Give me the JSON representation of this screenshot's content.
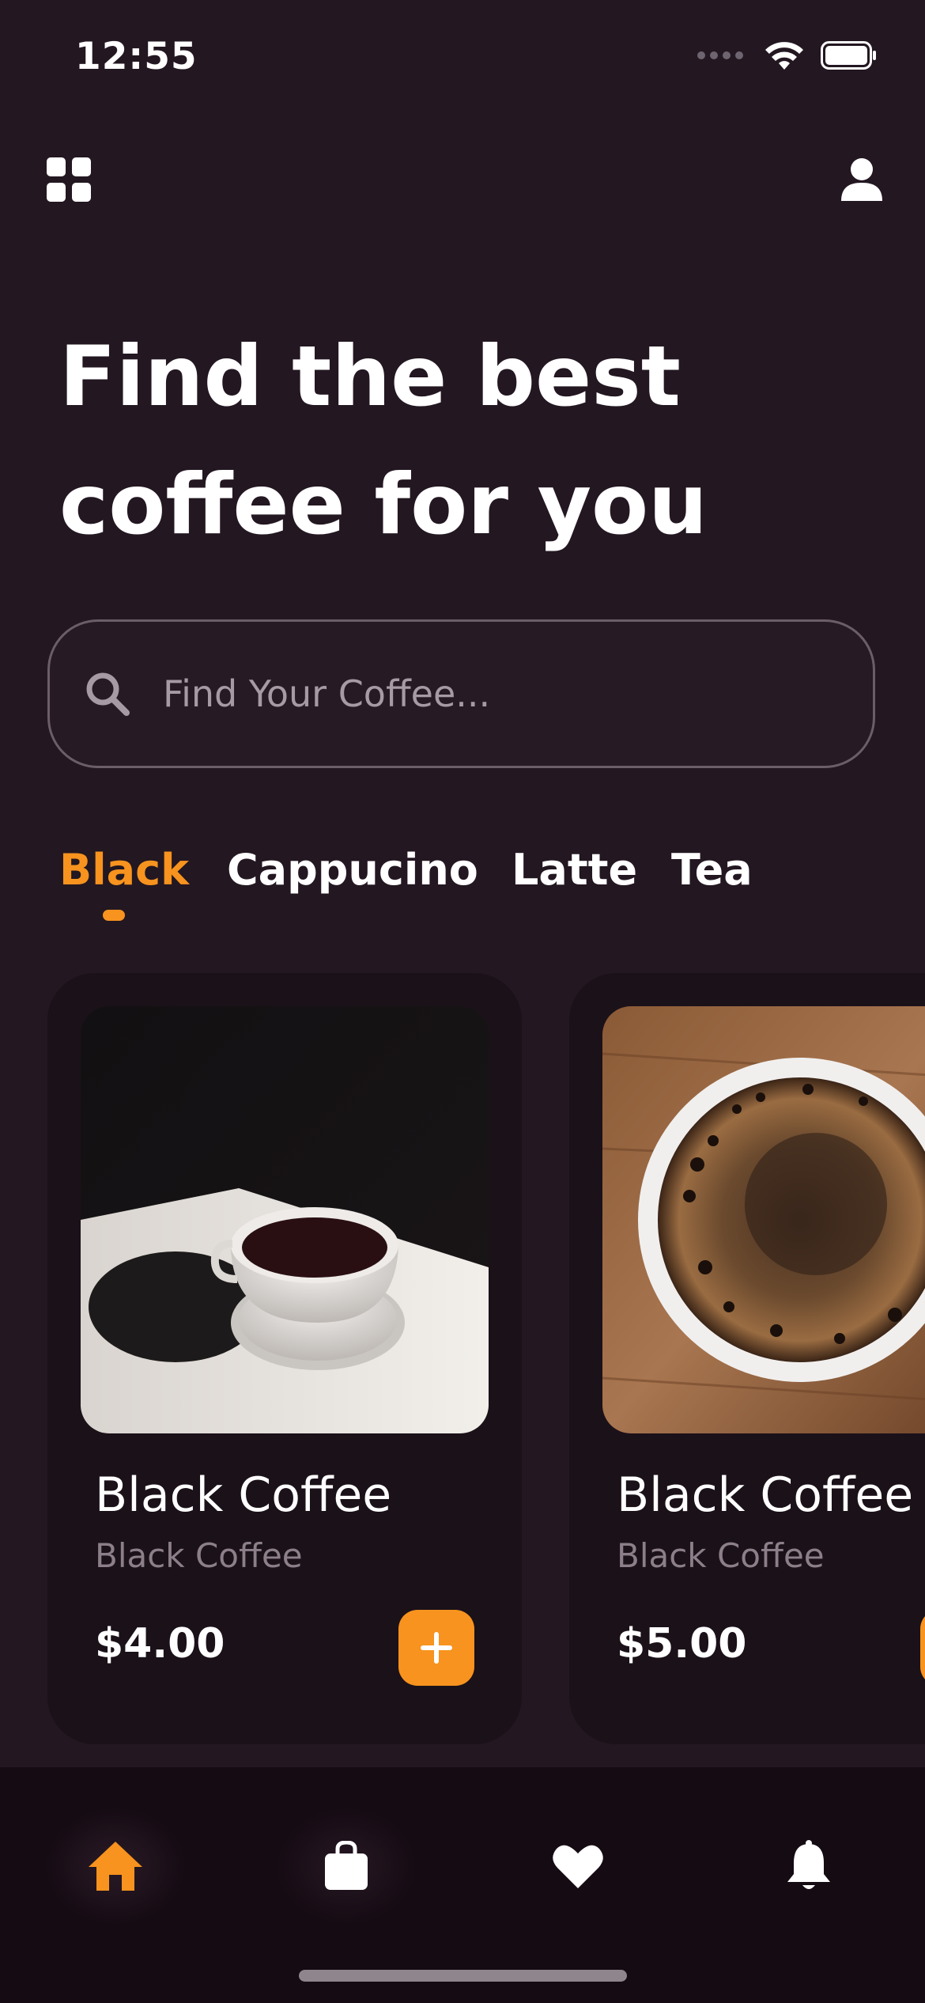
{
  "status_bar": {
    "time": "12:55"
  },
  "header": {
    "title_line1": "Find the best",
    "title_line2": "coffee for you"
  },
  "search": {
    "placeholder": "Find Your Coffee...",
    "value": ""
  },
  "tabs": [
    {
      "label": "Black",
      "active": true
    },
    {
      "label": "Cappucino",
      "active": false
    },
    {
      "label": "Latte",
      "active": false
    },
    {
      "label": "Tea",
      "active": false
    }
  ],
  "products": [
    {
      "title": "Black Coffee",
      "subtitle": "Black Coffee",
      "price": "$4.00"
    },
    {
      "title": "Black Coffee",
      "subtitle": "Black Coffee",
      "price": "$5.00"
    }
  ],
  "bottom_nav": [
    {
      "icon": "home-icon",
      "active": true
    },
    {
      "icon": "shopping-bag-icon",
      "active": false
    },
    {
      "icon": "heart-icon",
      "active": false
    },
    {
      "icon": "bell-icon",
      "active": false
    }
  ],
  "colors": {
    "background": "#231721",
    "accent": "#f7931e",
    "card": "#1b1119",
    "nav": "#150b13"
  }
}
